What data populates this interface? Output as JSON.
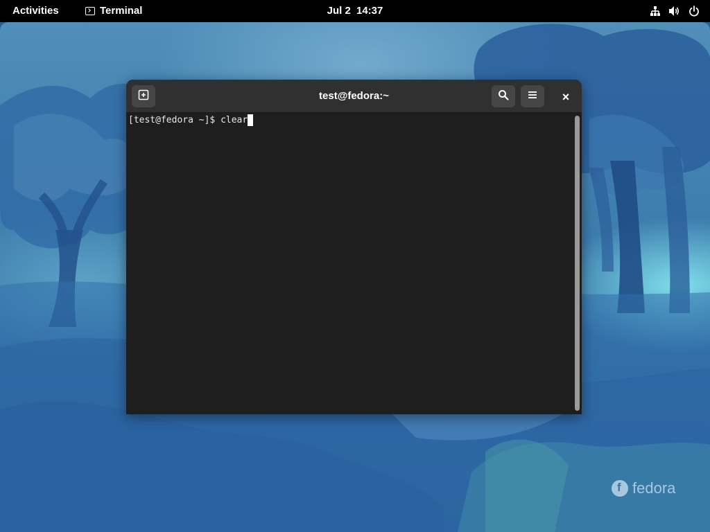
{
  "topbar": {
    "activities_label": "Activities",
    "app_name": "Terminal",
    "date": "Jul 2",
    "time": "14:37",
    "tray_icons": [
      "network-icon",
      "volume-icon",
      "power-icon"
    ]
  },
  "window": {
    "title": "test@fedora:~",
    "buttons": {
      "new_tab": "new-tab-icon",
      "search": "search-icon",
      "menu": "hamburger-menu-icon",
      "close": "×"
    }
  },
  "terminal": {
    "prompt": "[test@fedora ~]$ ",
    "command": "clear"
  },
  "desktop": {
    "logo_text": "fedora"
  },
  "colors": {
    "topbar_bg": "#000000",
    "headerbar_bg": "#303030",
    "terminal_bg": "#1e1e1e",
    "terminal_fg": "#e8e8e8"
  }
}
